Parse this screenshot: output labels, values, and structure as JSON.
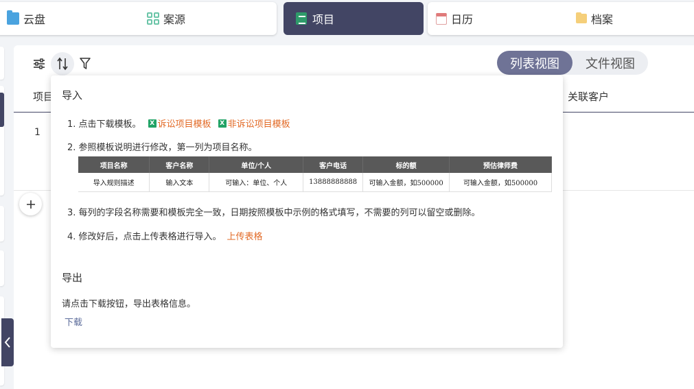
{
  "tabs": {
    "cloud": "云盘",
    "cases": "案源",
    "projects": "项目",
    "calendar": "日历",
    "archive": "档案"
  },
  "view_toggle": {
    "list": "列表视图",
    "file": "文件视图"
  },
  "table": {
    "col_project": "项目",
    "col_client": "关联客户",
    "row_number": "1"
  },
  "popover": {
    "import_title": "导入",
    "step1": "1. 点击下载模板。",
    "link_litigation": "诉讼项目模板",
    "link_non_litigation": "非诉讼项目模板",
    "step2": "2. 参照模板说明进行修改，第一列为项目名称。",
    "template_headers": [
      "项目名称",
      "客户名称",
      "单位/个人",
      "客户电话",
      "标的额",
      "预估律师费"
    ],
    "template_row": [
      "导入规则描述",
      "输入文本",
      "可输入：单位、个人",
      "13888888888",
      "可输入金额，如500000",
      "可输入金额，如500000"
    ],
    "step3": "3. 每列的字段名称需要和模板完全一致，日期按照模板中示例的格式填写，不需要的列可以留空或删除。",
    "step4": "4. 修改好后，点击上传表格进行导入。",
    "upload_link": "上传表格",
    "export_title": "导出",
    "export_desc": "请点击下载按钮，导出表格信息。",
    "download_link": "下载"
  },
  "colors": {
    "accent": "#424564",
    "toggle_active": "#6f7396",
    "link_orange": "#e26a26",
    "excel_green": "#21a366"
  }
}
